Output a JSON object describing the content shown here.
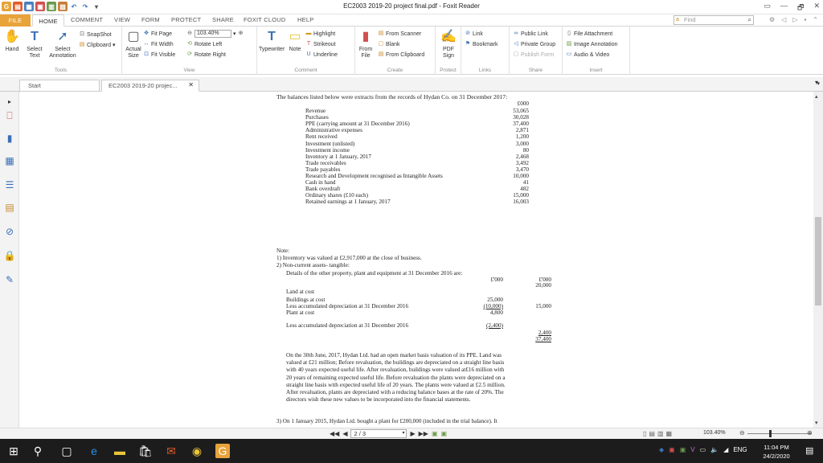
{
  "window": {
    "title": "EC2003 2019-20 project final.pdf - Foxit Reader",
    "controls": [
      "▭",
      "—",
      "🗗",
      "✕"
    ]
  },
  "ribbon_tabs": [
    "FILE",
    "HOME",
    "COMMENT",
    "VIEW",
    "FORM",
    "PROTECT",
    "SHARE",
    "FOXIT CLOUD",
    "HELP"
  ],
  "find": {
    "placeholder": "Find"
  },
  "ribbon": {
    "tools": {
      "label": "Tools",
      "hand": "Hand",
      "select_text": "Select Text",
      "select_annotation": "Select Annotation",
      "snapshot": "SnapShot",
      "clipboard": "Clipboard"
    },
    "view": {
      "label": "View",
      "actual_size": "Actual Size",
      "fit_page": "Fit Page",
      "fit_width": "Fit Width",
      "fit_visible": "Fit Visible",
      "zoom": "103.40%",
      "rotate_left": "Rotate Left",
      "rotate_right": "Rotate Right"
    },
    "comment": {
      "label": "Comment",
      "typewriter": "Typewriter",
      "note": "Note",
      "highlight": "Highlight",
      "strikeout": "Strikeout",
      "underline": "Underline"
    },
    "create": {
      "label": "Create",
      "from_file": "From File",
      "from_scanner": "From Scanner",
      "blank": "Blank",
      "from_clipboard": "From Clipboard"
    },
    "protect": {
      "label": "Protect",
      "pdf_sign": "PDF Sign"
    },
    "links": {
      "label": "Links",
      "link": "Link",
      "bookmark": "Bookmark"
    },
    "share": {
      "label": "Share",
      "public_link": "Public Link",
      "private_group": "Private Group",
      "publish_form": "Publish Form"
    },
    "insert": {
      "label": "Insert",
      "file_attachment": "File Attachment",
      "image_annotation": "Image Annotation",
      "audio_video": "Audio & Video"
    }
  },
  "doc_tabs": {
    "start": "Start",
    "file": "EC2003 2019-20 projec..."
  },
  "document": {
    "intro": "The balances listed below were extracts from the records of Hydan Co. on 31 December 2017:",
    "unit": "£000",
    "balances": [
      {
        "item": "Revenue",
        "value": "53,065"
      },
      {
        "item": "Purchases",
        "value": "30,028"
      },
      {
        "item": "PPE (carrying amount at 31 December 2016)",
        "value": "37,400"
      },
      {
        "item": "Administrative expenses",
        "value": "2,871"
      },
      {
        "item": "Rent received",
        "value": "1,200"
      },
      {
        "item": "Investment (unlisted)",
        "value": "3,000"
      },
      {
        "item": "Investment income",
        "value": "80"
      },
      {
        "item": "Inventory at 1 January, 2017",
        "value": "2,468"
      },
      {
        "item": "Trade receivables",
        "value": "3,492"
      },
      {
        "item": "Trade payables",
        "value": "3,470"
      },
      {
        "item": "Research and Development recognised as Intangible Assets",
        "value": "10,000"
      },
      {
        "item": "Cash in hand",
        "value": "41"
      },
      {
        "item": "Bank overdraft",
        "value": "482"
      },
      {
        "item": "Ordinary shares (£10 each)",
        "value": "15,000"
      },
      {
        "item": "Retained earnings at 1 January, 2017",
        "value": "16,003"
      }
    ],
    "note_title": "Note:",
    "note1": "1)  Inventory was valued at £2,917,000 at the close of business.",
    "note2": "2)  Non-current assets- tangible:",
    "ppe_intro": "Details of the other property, plant and equipment at 31 December 2016 are:",
    "ppe_col1": "£'000",
    "ppe_col2": "£'000",
    "ppe_rows": [
      {
        "item": "Land at cost",
        "c1": "",
        "c2": "20,000"
      },
      {
        "item": "Buildings at cost",
        "c1": "25,000",
        "c2": ""
      },
      {
        "item": "Less accumulated depreciation at 31 December 2016",
        "c1": "(10,000)",
        "c2": "15,000"
      },
      {
        "item": "Plant at cost",
        "c1": "4,800",
        "c2": ""
      },
      {
        "item": "Less accumulated depreciation at 31 December 2016",
        "c1": "(2,400)",
        "c2": ""
      }
    ],
    "ppe_sub": "2,400",
    "ppe_total": "37,400",
    "para": [
      "On the 30th June, 2017, Hydan Ltd. had an open market basis valuation of its PPE. Land was",
      "valued at £21 million; Before revaluation, the buildings are depreciated on a straight line basis",
      "with 40 years expected useful life. After revaluation, buildings were valued at£16 million with",
      "20 years of remaining expected useful life. Before revaluation the plants were depreciated on a",
      "straight line basis with expected useful life of 20 years. The plants were valued at £2.5 million.",
      "After revaluation, plants are depreciated with a reducing balance bases at the rate of 20%. The",
      "directors wish these new values to be incorporated into the financial statements."
    ],
    "note3": "3)  On 1 January 2015, Hydan Ltd. bought a plant for £200,000 (included in the trial balance). It"
  },
  "status": {
    "page": "2 / 3",
    "zoom": "103.40%"
  },
  "taskbar": {
    "time": "11:04 PM",
    "date": "24/2/2020",
    "lang": "ENG"
  },
  "colors": {
    "accent": "#e8a33a",
    "taskbar": "#1c1c1c"
  }
}
